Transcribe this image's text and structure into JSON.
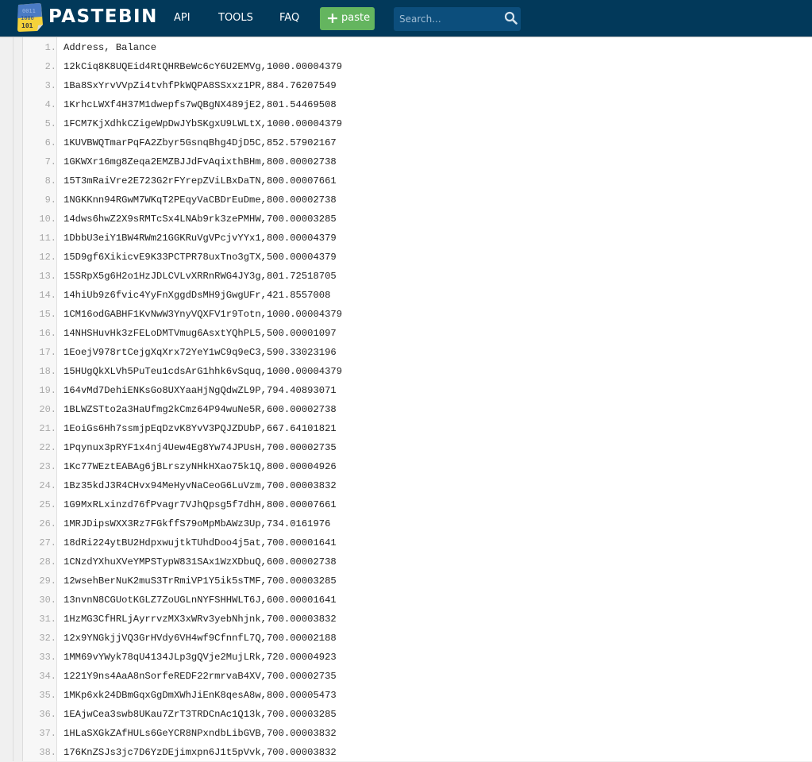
{
  "header": {
    "brand": "PASTEBIN",
    "logo_icon": "pastebin-logo-icon",
    "nav": [
      {
        "label": "API"
      },
      {
        "label": "TOOLS"
      },
      {
        "label": "FAQ"
      }
    ],
    "paste_button": {
      "icon": "plus-icon",
      "label": "paste"
    },
    "search": {
      "placeholder": "Search...",
      "value": "",
      "icon": "search-icon"
    }
  },
  "colors": {
    "header_bg": "#02395a",
    "paste_button_bg": "#64b55f",
    "search_bg": "#0c4e7c"
  },
  "code": {
    "lines": [
      {
        "num": "1.",
        "text": "Address, Balance"
      },
      {
        "num": "2.",
        "text": "12kCiq8K8UQEid4RtQHRBeWc6cY6U2EMVg,1000.00004379"
      },
      {
        "num": "3.",
        "text": "1Ba8SxYrvVVpZi4tvhfPkWQPA8SSxxz1PR,884.76207549"
      },
      {
        "num": "4.",
        "text": "1KrhcLWXf4H37M1dwepfs7wQBgNX489jE2,801.54469508"
      },
      {
        "num": "5.",
        "text": "1FCM7KjXdhkCZigeWpDwJYbSKgxU9LWLtX,1000.00004379"
      },
      {
        "num": "6.",
        "text": "1KUVBWQTmarPqFA2Zbyr5GsnqBhg4DjD5C,852.57902167"
      },
      {
        "num": "7.",
        "text": "1GKWXr16mg8Zeqa2EMZBJJdFvAqixthBHm,800.00002738"
      },
      {
        "num": "8.",
        "text": "15T3mRaiVre2E723G2rFYrepZViLBxDaTN,800.00007661"
      },
      {
        "num": "9.",
        "text": "1NGKKnn94RGwM7WKqT2PEqyVaCBDrEuDme,800.00002738"
      },
      {
        "num": "10.",
        "text": "14dws6hwZ2X9sRMTcSx4LNAb9rk3zePMHW,700.00003285"
      },
      {
        "num": "11.",
        "text": "1DbbU3eiY1BW4RWm21GGKRuVgVPcjvYYx1,800.00004379"
      },
      {
        "num": "12.",
        "text": "15D9gf6XikicvE9K33PCTPR78uxTno3gTX,500.00004379"
      },
      {
        "num": "13.",
        "text": "15SRpX5g6H2o1HzJDLCVLvXRRnRWG4JY3g,801.72518705"
      },
      {
        "num": "14.",
        "text": "14hiUb9z6fvic4YyFnXggdDsMH9jGwgUFr,421.8557008"
      },
      {
        "num": "15.",
        "text": "1CM16odGABHF1KvNwW3YnyVQXFV1r9Totn,1000.00004379"
      },
      {
        "num": "16.",
        "text": "14NHSHuvHk3zFELoDMTVmug6AsxtYQhPL5,500.00001097"
      },
      {
        "num": "17.",
        "text": "1EoejV978rtCejgXqXrx72YeY1wC9q9eC3,590.33023196"
      },
      {
        "num": "18.",
        "text": "15HUgQkXLVh5PuTeu1cdsArG1hhk6vSquq,1000.00004379"
      },
      {
        "num": "19.",
        "text": "164vMd7DehiENKsGo8UXYaaHjNgQdwZL9P,794.40893071"
      },
      {
        "num": "20.",
        "text": "1BLWZSTto2a3HaUfmg2kCmz64P94wuNe5R,600.00002738"
      },
      {
        "num": "21.",
        "text": "1EoiGs6Hh7ssmjpEqDzvK8YvV3PQJZDUbP,667.64101821"
      },
      {
        "num": "22.",
        "text": "1Pqynux3pRYF1x4nj4Uew4Eg8Yw74JPUsH,700.00002735"
      },
      {
        "num": "23.",
        "text": "1Kc77WEztEABAg6jBLrszyNHkHXao75k1Q,800.00004926"
      },
      {
        "num": "24.",
        "text": "1Bz35kdJ3R4CHvx94MeHyvNaCeoG6LuVzm,700.00003832"
      },
      {
        "num": "25.",
        "text": "1G9MxRLxinzd76fPvagr7VJhQpsg5f7dhH,800.00007661"
      },
      {
        "num": "26.",
        "text": "1MRJDipsWXX3Rz7FGkffS79oMpMbAWz3Up,734.0161976"
      },
      {
        "num": "27.",
        "text": "18dRi224ytBU2HdpxwujtkTUhdDoo4j5at,700.00001641"
      },
      {
        "num": "28.",
        "text": "1CNzdYXhuXVeYMPSTypW831SAx1WzXDbuQ,600.00002738"
      },
      {
        "num": "29.",
        "text": "12wsehBerNuK2muS3TrRmiVP1Y5ik5sTMF,700.00003285"
      },
      {
        "num": "30.",
        "text": "13nvnN8CGUotKGLZ7ZoUGLnNYFSHHWLT6J,600.00001641"
      },
      {
        "num": "31.",
        "text": "1HzMG3CfHRLjAyrrvzMX3xWRv3yebNhjnk,700.00003832"
      },
      {
        "num": "32.",
        "text": "12x9YNGkjjVQ3GrHVdy6VH4wf9CfnnfL7Q,700.00002188"
      },
      {
        "num": "33.",
        "text": "1MM69vYWyk78qU4134JLp3gQVje2MujLRk,720.00004923"
      },
      {
        "num": "34.",
        "text": "1221Y9ns4AaA8nSorfeREDF22rmrvaB4XV,700.00002735"
      },
      {
        "num": "35.",
        "text": "1MKp6xk24DBmGqxGgDmXWhJiEnK8qesA8w,800.00005473"
      },
      {
        "num": "36.",
        "text": "1EAjwCea3swb8UKau7ZrT3TRDCnAc1Q13k,700.00003285"
      },
      {
        "num": "37.",
        "text": "1HLaSXGkZAfHULs6GeYCR8NPxndbLibGVB,700.00003832"
      },
      {
        "num": "38.",
        "text": "176KnZSJs3jc7D6YzDEjimxpn6J1t5pVvk,700.00003832"
      }
    ]
  }
}
